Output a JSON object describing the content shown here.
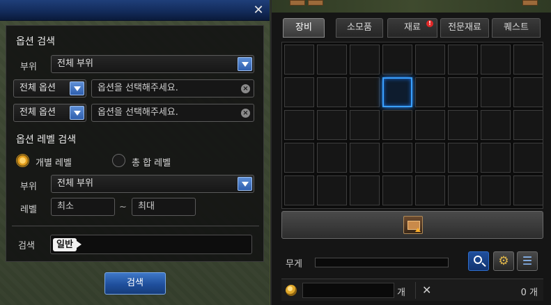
{
  "left_panel": {
    "close_glyph": "✕",
    "option_search": {
      "title": "옵션 검색",
      "part_label": "부위",
      "part_value": "전체 부위",
      "rows": [
        {
          "option_value": "전체 옵션",
          "placeholder": "옵션을 선택해주세요."
        },
        {
          "option_value": "전체 옵션",
          "placeholder": "옵션을 선택해주세요."
        }
      ]
    },
    "level_search": {
      "title": "옵션 레벨 검색",
      "radio_individual": "개별 레벨",
      "radio_total": "총 합 레벨",
      "selected": "individual",
      "part_label": "부위",
      "part_value": "전체 부위",
      "level_label": "레벨",
      "min_placeholder": "최소",
      "tilde": "~",
      "max_placeholder": "최대"
    },
    "search": {
      "label": "검색",
      "tag": "일반",
      "button_label": "검색"
    }
  },
  "right_panel": {
    "tabs": [
      {
        "label": "장비",
        "active": true
      },
      {
        "label": "소모품",
        "active": false
      },
      {
        "label": "재료",
        "active": false,
        "alert": "!"
      },
      {
        "label": "전문재료",
        "active": false
      },
      {
        "label": "퀘스트",
        "active": false
      }
    ],
    "grid": {
      "rows": 5,
      "cols": 8,
      "selected_index": 11
    },
    "weight_label": "무게",
    "weight_fraction": 0,
    "bottom": {
      "gold_unit": "개",
      "count_text": "0 개"
    },
    "icons": {
      "search": "magnifier-icon",
      "settings": "gear-icon",
      "list": "list-icon",
      "expand": "expand-inventory-icon",
      "coin": "coin-icon",
      "swords": "crossed-swords-icon"
    },
    "colors": {
      "selected_slot": "#3aa0ff",
      "accent_blue": "#2f6fd0",
      "alert_red": "#e02828"
    }
  }
}
